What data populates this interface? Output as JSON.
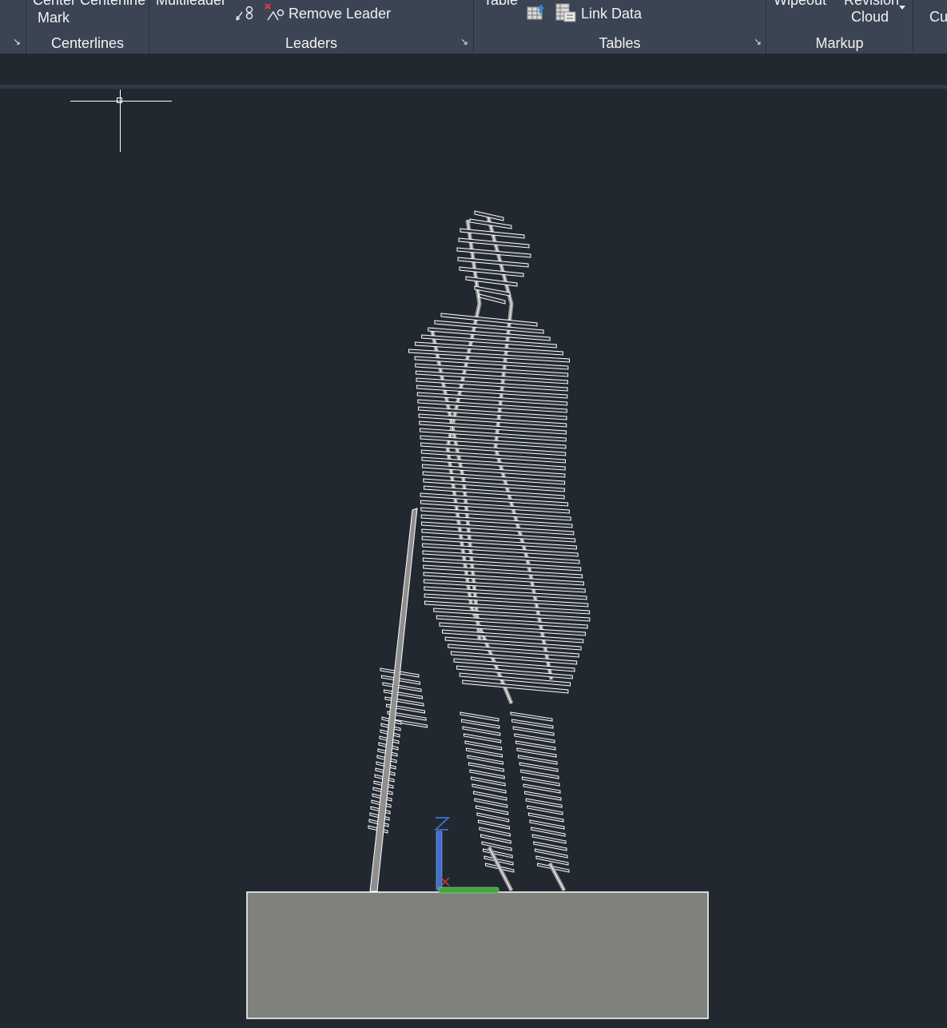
{
  "ribbon": {
    "centerlines": {
      "cut_text": "Center  Centerline",
      "mark_label": "Mark",
      "panel_label": "Centerlines"
    },
    "leaders": {
      "cut_text": "Multileader",
      "remove_leader_label": "Remove Leader",
      "panel_label": "Leaders"
    },
    "tables": {
      "cut_text": "Table",
      "link_data_label": "Link Data",
      "panel_label": "Tables"
    },
    "markup": {
      "cut_wipeout": "Wipeout",
      "cut_revision": "Revision",
      "cloud_label": "Cloud",
      "panel_label": "Markup"
    },
    "next_panel_cut": "Cu"
  },
  "colors": {
    "ribbon_bg": "#3b4453",
    "viewport_bg": "#212830",
    "model_edge": "#ffffff",
    "model_fill": "#8a8a8a",
    "base_fill": "#7f817d",
    "ucs_x": "#d23c3c",
    "ucs_y": "#3fa63a",
    "ucs_z": "#3f6fd2"
  },
  "icons": [
    "add-leader-icon",
    "remove-leader-icon",
    "extract-data-icon",
    "link-data-icon",
    "dropdown-arrow-icon",
    "panel-launcher-icon"
  ]
}
